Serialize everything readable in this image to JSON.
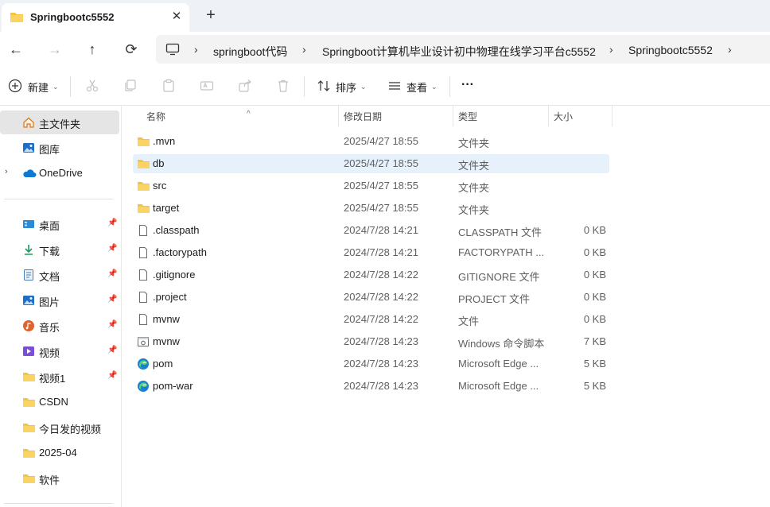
{
  "window": {
    "tab_title": "Springbootc5552",
    "close_glyph": "✕",
    "new_tab_glyph": "+"
  },
  "nav": {
    "back_glyph": "←",
    "forward_glyph": "→",
    "up_glyph": "↑",
    "refresh_glyph": "⟳"
  },
  "breadcrumb": {
    "items": [
      "springboot代码",
      "Springboot计算机毕业设计初中物理在线学习平台c5552",
      "Springbootc5552"
    ],
    "separator": "›"
  },
  "toolbar": {
    "new_label": "新建",
    "sort_label": "排序",
    "view_label": "查看",
    "more_label": "···"
  },
  "sidebar": {
    "home": "主文件夹",
    "gallery": "图库",
    "onedrive": "OneDrive",
    "pinned": [
      {
        "label": "桌面",
        "icon": "desktop-icon"
      },
      {
        "label": "下载",
        "icon": "download-icon"
      },
      {
        "label": "文档",
        "icon": "document-icon"
      },
      {
        "label": "图片",
        "icon": "pictures-icon"
      },
      {
        "label": "音乐",
        "icon": "music-icon"
      },
      {
        "label": "视频",
        "icon": "video-icon"
      },
      {
        "label": "视频1",
        "icon": "folder-icon"
      }
    ],
    "folders": [
      "CSDN",
      "今日发的视频",
      "2025-04",
      "软件"
    ]
  },
  "columns": {
    "name": "名称",
    "date": "修改日期",
    "type": "类型",
    "size": "大小"
  },
  "files": [
    {
      "name": ".mvn",
      "date": "2025/4/27 18:55",
      "type": "文件夹",
      "size": "",
      "icon": "folder-icon"
    },
    {
      "name": "db",
      "date": "2025/4/27 18:55",
      "type": "文件夹",
      "size": "",
      "icon": "folder-icon"
    },
    {
      "name": "src",
      "date": "2025/4/27 18:55",
      "type": "文件夹",
      "size": "",
      "icon": "folder-icon"
    },
    {
      "name": "target",
      "date": "2025/4/27 18:55",
      "type": "文件夹",
      "size": "",
      "icon": "folder-icon"
    },
    {
      "name": ".classpath",
      "date": "2024/7/28 14:21",
      "type": "CLASSPATH 文件",
      "size": "0 KB",
      "icon": "file-icon"
    },
    {
      "name": ".factorypath",
      "date": "2024/7/28 14:21",
      "type": "FACTORYPATH ...",
      "size": "0 KB",
      "icon": "file-icon"
    },
    {
      "name": ".gitignore",
      "date": "2024/7/28 14:22",
      "type": "GITIGNORE 文件",
      "size": "0 KB",
      "icon": "file-icon"
    },
    {
      "name": ".project",
      "date": "2024/7/28 14:22",
      "type": "PROJECT 文件",
      "size": "0 KB",
      "icon": "file-icon"
    },
    {
      "name": "mvnw",
      "date": "2024/7/28 14:22",
      "type": "文件",
      "size": "0 KB",
      "icon": "file-icon"
    },
    {
      "name": "mvnw",
      "date": "2024/7/28 14:23",
      "type": "Windows 命令脚本",
      "size": "7 KB",
      "icon": "script-icon"
    },
    {
      "name": "pom",
      "date": "2024/7/28 14:23",
      "type": "Microsoft Edge ...",
      "size": "5 KB",
      "icon": "edge-icon"
    },
    {
      "name": "pom-war",
      "date": "2024/7/28 14:23",
      "type": "Microsoft Edge ...",
      "size": "5 KB",
      "icon": "edge-icon"
    }
  ],
  "colors": {
    "folder": "#f8c440",
    "accent": "#0067c0",
    "hover_row": "#e6f1fc"
  }
}
